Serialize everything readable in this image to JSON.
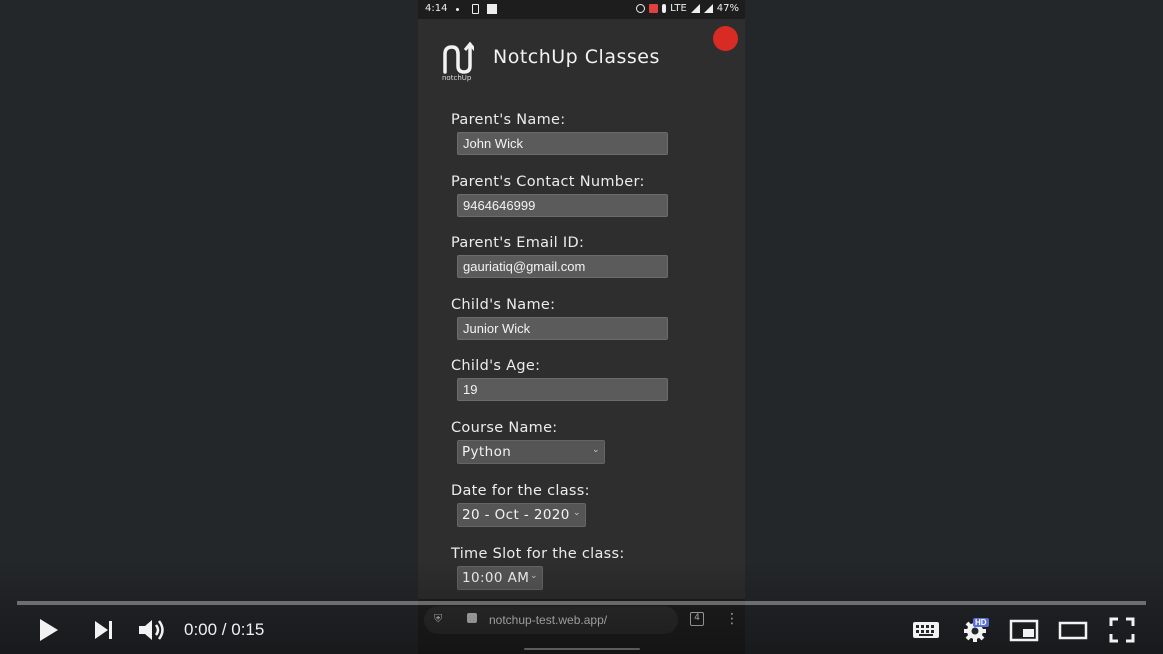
{
  "statusbar": {
    "time": "4:14",
    "network": "LTE",
    "battery": "47%"
  },
  "app": {
    "title": "NotchUp Classes",
    "logo_text": "notchUp"
  },
  "form": {
    "parent_name_label": "Parent's Name:",
    "parent_name_value": "John Wick",
    "contact_label": "Parent's Contact Number:",
    "contact_value": "9464646999",
    "email_label": "Parent's Email ID:",
    "email_value": "gauriatiq@gmail.com",
    "child_name_label": "Child's Name:",
    "child_name_value": "Junior Wick",
    "child_age_label": "Child's Age:",
    "child_age_value": "19",
    "course_label": "Course Name:",
    "course_value": "Python",
    "date_label": "Date for the class:",
    "date_value": "20 - Oct - 2020",
    "time_label": "Time Slot for the class:",
    "time_value": "10:00 AM"
  },
  "browser": {
    "url": "notchup-test.web.app/",
    "tab_count": "4"
  },
  "player": {
    "time_display": "0:00 / 0:15",
    "progress_fraction": 0,
    "hd_badge": "HD"
  }
}
